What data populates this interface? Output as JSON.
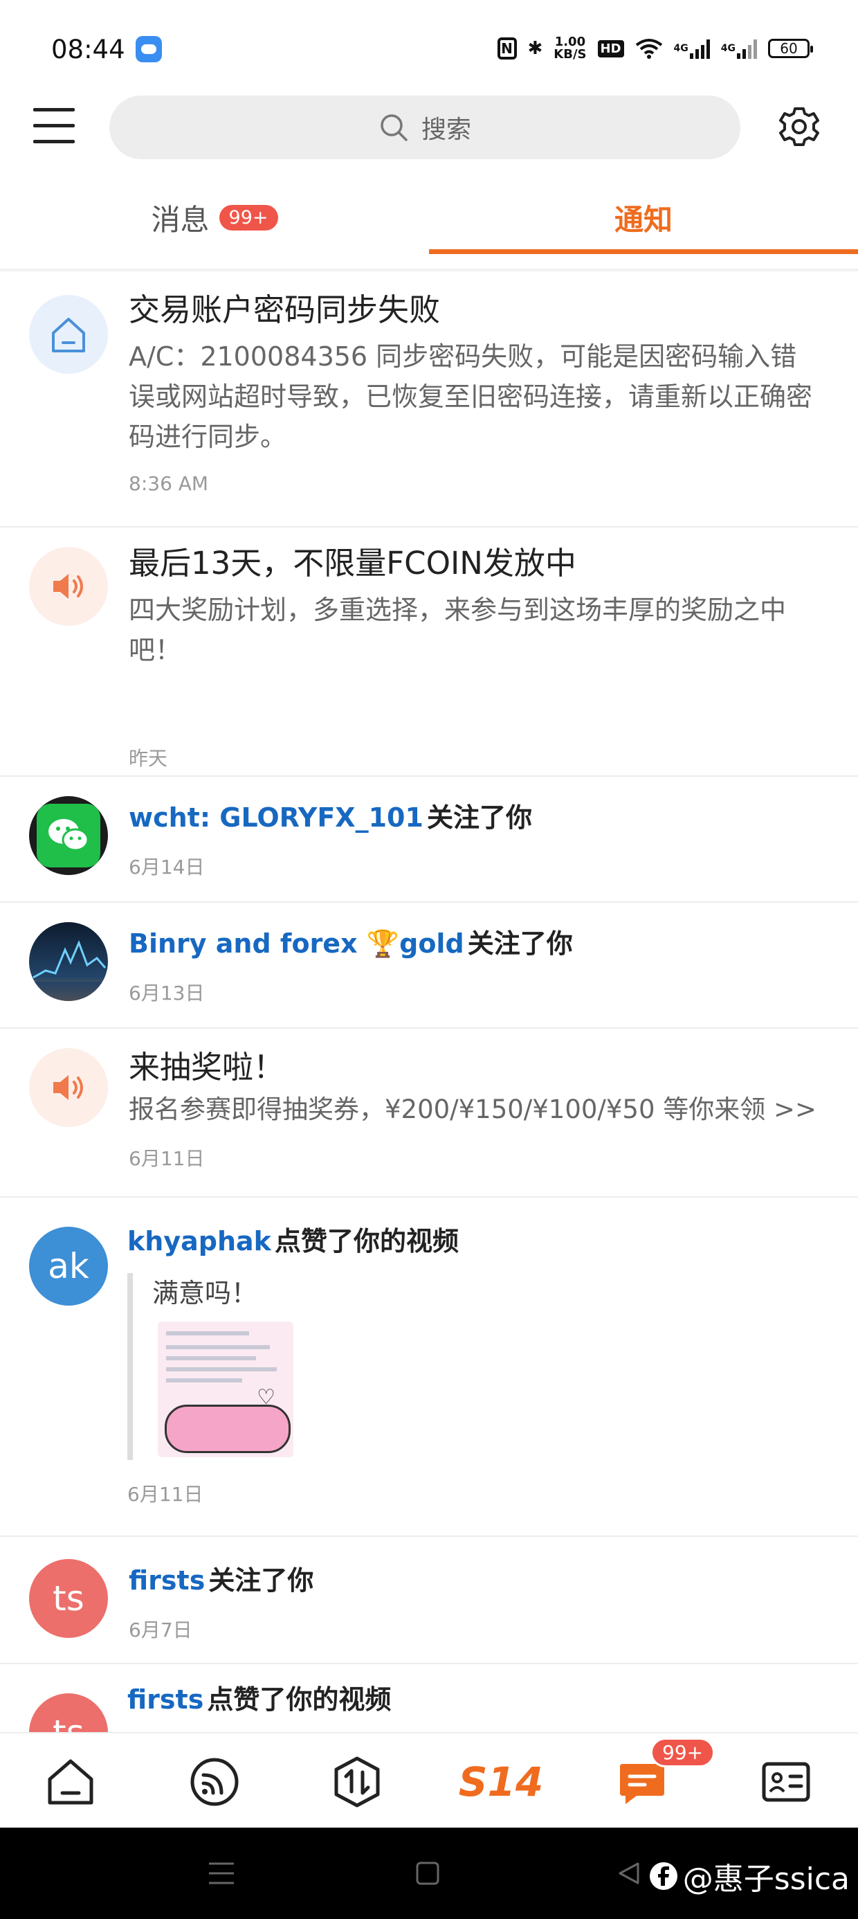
{
  "status": {
    "time": "08:44",
    "speed": "1.00\nKB/S",
    "hd": "HD",
    "net1": "4G",
    "net2": "4G",
    "battery": "60"
  },
  "header": {
    "search_placeholder": "搜索"
  },
  "tabs": [
    {
      "label": "消息",
      "badge": "99+"
    },
    {
      "label": "通知"
    }
  ],
  "notifications": [
    {
      "type": "system",
      "title": "交易账户密码同步失败",
      "body": "A/C：2100084356 同步密码失败，可能是因密码输入错误或网站超时导致，已恢复至旧密码连接，请重新以正确密码进行同步。",
      "time": "8:36 AM"
    },
    {
      "type": "announcement",
      "title": "最后13天，不限量FCOIN发放中",
      "body": "四大奖励计划，多重选择，来参与到这场丰厚的奖励之中吧！",
      "time": "昨天"
    },
    {
      "type": "follow",
      "user": "wcht: GLORYFX_101",
      "action": "关注了你",
      "time": "6月14日"
    },
    {
      "type": "follow",
      "user": "Binry and forex 🏆gold",
      "action": "关注了你",
      "time": "6月13日"
    },
    {
      "type": "announcement",
      "title": "来抽奖啦！",
      "body": "报名参赛即得抽奖券，¥200/¥150/¥100/¥50 等你来领 >>",
      "time": "6月11日"
    },
    {
      "type": "like",
      "avatar": "ak",
      "user": "khyaphak",
      "action": "点赞了你的视频",
      "quote": "满意吗！",
      "time": "6月11日"
    },
    {
      "type": "follow",
      "avatar": "ts",
      "user": "firsts",
      "action": "关注了你",
      "time": "6月7日"
    },
    {
      "type": "like",
      "avatar": "ts",
      "user": "firsts",
      "action": "点赞了你的视频"
    }
  ],
  "bottom_nav": {
    "logo": "S14",
    "badge": "99+"
  },
  "watermark": "@惠子ssica",
  "colors": {
    "accent": "#ef6c1f",
    "link": "#1768c1",
    "badge": "#f05549"
  }
}
